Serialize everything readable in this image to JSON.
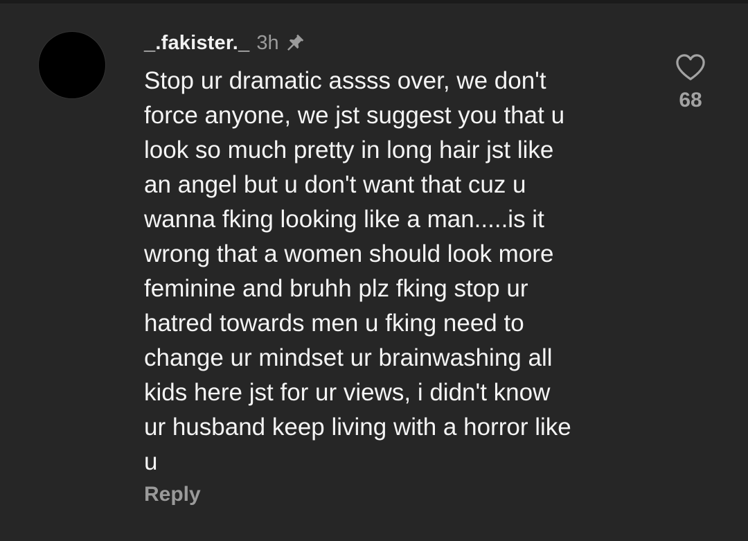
{
  "comment": {
    "username": "_.fakister._",
    "time": "3h",
    "pinned_icon": "pin-icon",
    "text_lines": [
      "Stop ur dramatic assss over, we don't",
      "force anyone, we jst suggest you that u",
      "look so much pretty in long hair jst like",
      "an angel but u don't want that cuz u",
      "wanna fking looking like a man.....is it",
      "wrong that a women should look more",
      "feminine and bruhh plz fking stop ur",
      "hatred towards men u fking need to",
      "change ur mindset ur brainwashing all",
      "kids here jst for ur views, i didn't know",
      "ur husband keep living with a horror like",
      "u"
    ],
    "reply_label": "Reply",
    "like_icon": "heart-outline-icon",
    "like_count": "68"
  },
  "colors": {
    "background": "#262626",
    "text": "#f4f4f4",
    "muted": "#9b9b9b"
  }
}
